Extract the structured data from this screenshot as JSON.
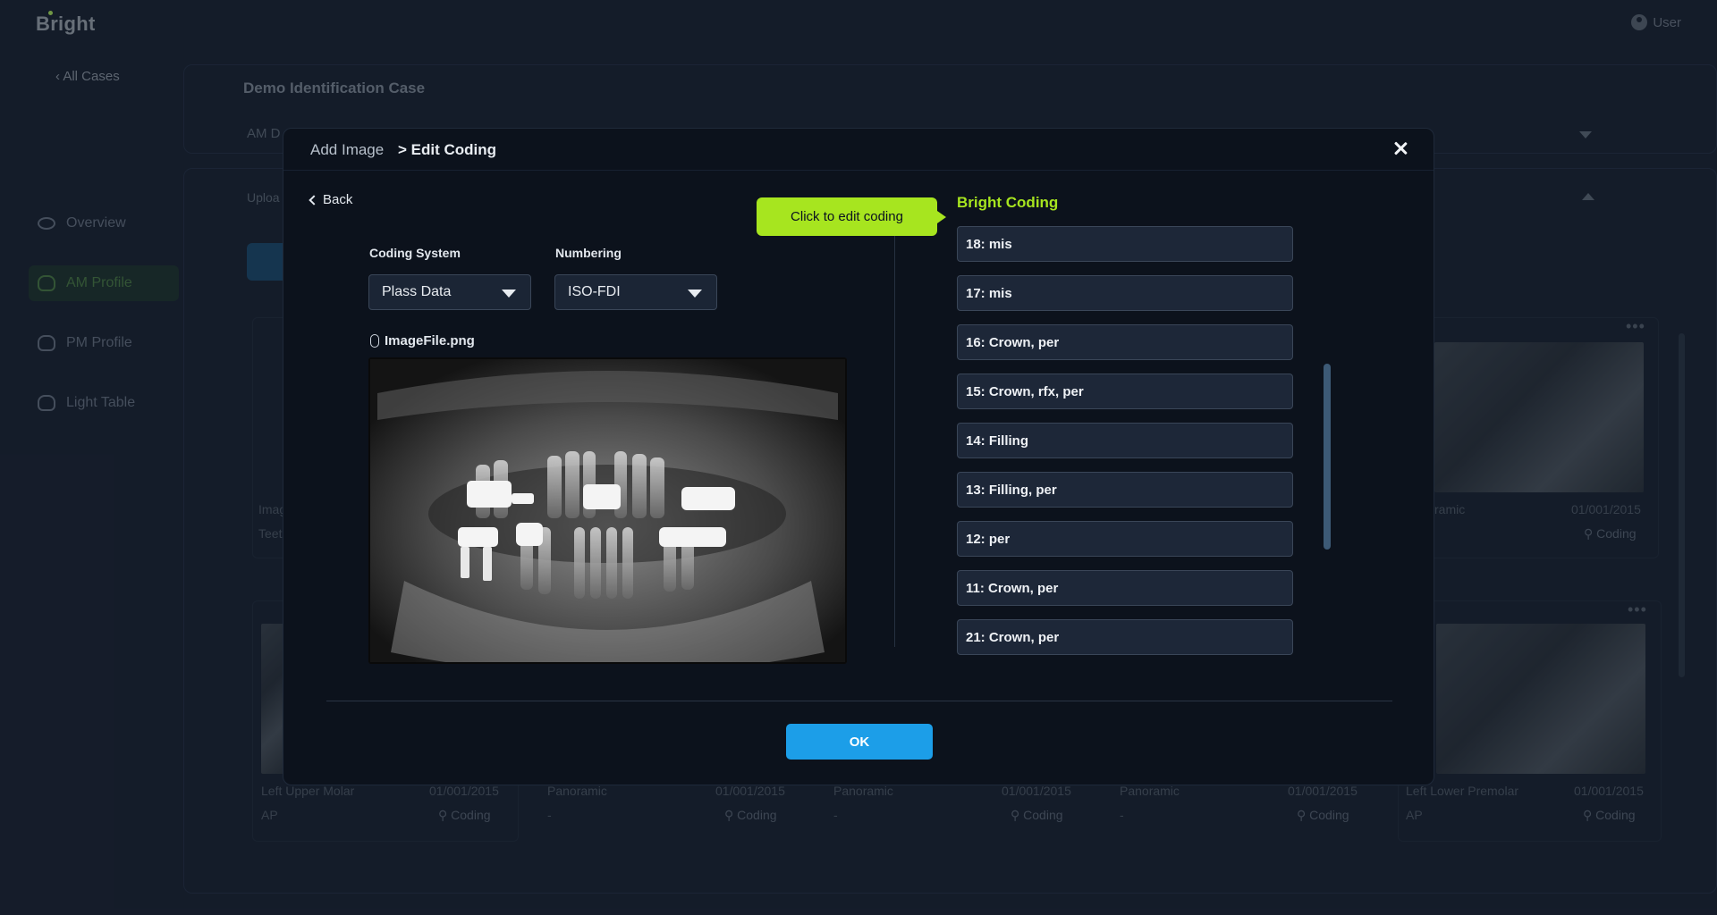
{
  "app": {
    "logo": "Bright",
    "user_label": "User"
  },
  "nav": {
    "back_label": "All Cases",
    "items": [
      {
        "label": "Overview",
        "icon": "eye-icon"
      },
      {
        "label": "AM Profile",
        "icon": "tooth-icon",
        "active": true
      },
      {
        "label": "PM Profile",
        "icon": "tooth-icon"
      },
      {
        "label": "Light Table",
        "icon": "lamp-icon"
      }
    ]
  },
  "case": {
    "title": "Demo Identification Case",
    "subtitle_partial": "AM D",
    "upload_partial": "Uploa"
  },
  "bg_tiles": {
    "top_left": {
      "meta1": "Imag",
      "meta2": "Teet"
    },
    "top_right": {
      "type": "ramic",
      "date": "01/001/2015",
      "coding": "Coding"
    },
    "bottom": [
      {
        "type": "Left Upper Molar",
        "date": "01/001/2015",
        "sub": "AP",
        "coding": "Coding"
      },
      {
        "type": "Panoramic",
        "date": "01/001/2015",
        "sub": "-",
        "coding": "Coding"
      },
      {
        "type": "Panoramic",
        "date": "01/001/2015",
        "sub": "-",
        "coding": "Coding"
      },
      {
        "type": "Panoramic",
        "date": "01/001/2015",
        "sub": "-",
        "coding": "Coding"
      },
      {
        "type": "Left Lower Premolar",
        "date": "01/001/2015",
        "sub": "AP",
        "coding": "Coding"
      }
    ]
  },
  "modal": {
    "breadcrumb_parent": "Add Image",
    "breadcrumb_current": "> Edit Coding",
    "back_label": "Back",
    "coding_system": {
      "label": "Coding System",
      "value": "Plass Data"
    },
    "numbering": {
      "label": "Numbering",
      "value": "ISO-FDI"
    },
    "file_name": "ImageFile.png",
    "tooltip": "Click to edit coding",
    "bright_coding_title": "Bright Coding",
    "coding_items": [
      "18: mis",
      "17: mis",
      "16: Crown, per",
      "15: Crown, rfx, per",
      "14: Filling",
      "13: Filling, per",
      "12: per",
      "11: Crown, per",
      "21: Crown, per"
    ],
    "ok_label": "OK"
  },
  "colors": {
    "accent_green": "#a7e51f",
    "primary_blue": "#1c9ee8",
    "modal_bg": "#0c121c"
  }
}
